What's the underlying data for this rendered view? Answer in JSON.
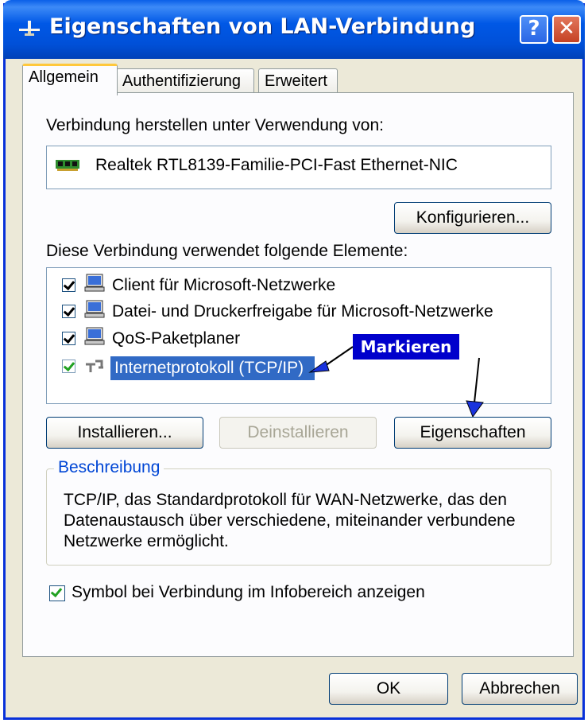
{
  "window": {
    "title": "Eigenschaften von LAN-Verbindung",
    "help_label": "?",
    "close_label": "✕"
  },
  "tabs": [
    {
      "label": "Allgemein",
      "active": true
    },
    {
      "label": "Authentifizierung",
      "active": false
    },
    {
      "label": "Erweitert",
      "active": false
    }
  ],
  "connect_using": {
    "label": "Verbindung herstellen unter Verwendung von:",
    "adapter": "Realtek RTL8139-Familie-PCI-Fast Ethernet-NIC",
    "adapter_icon": "network-card-icon",
    "configure_label": "Konfigurieren..."
  },
  "components": {
    "label": "Diese Verbindung verwendet folgende Elemente:",
    "items": [
      {
        "label": "Client für Microsoft-Netzwerke",
        "checked": true,
        "icon": "computer-icon"
      },
      {
        "label": "Datei- und Druckerfreigabe für Microsoft-Netzwerke",
        "checked": true,
        "icon": "computer-icon"
      },
      {
        "label": "QoS-Paketplaner",
        "checked": true,
        "icon": "computer-icon"
      },
      {
        "label": "Internetprotokoll (TCP/IP)",
        "checked": true,
        "icon": "protocol-icon",
        "selected": true
      }
    ],
    "install_label": "Installieren...",
    "uninstall_label": "Deinstallieren",
    "properties_label": "Eigenschaften"
  },
  "description": {
    "legend": "Beschreibung",
    "lines": [
      "TCP/IP, das Standardprotokoll für WAN-Netzwerke, das den",
      "Datenaustausch über verschiedene, miteinander verbundene",
      "Netzwerke ermöglicht."
    ]
  },
  "show_icon": {
    "label": "Symbol bei Verbindung im Infobereich anzeigen",
    "checked": true
  },
  "footer": {
    "ok_label": "OK",
    "cancel_label": "Abbrechen"
  },
  "annotation": {
    "label": "Markieren",
    "color": "#0000cc"
  },
  "colors": {
    "titlebar": "#0058e6",
    "selection": "#316ac5",
    "legend": "#0046d5"
  }
}
